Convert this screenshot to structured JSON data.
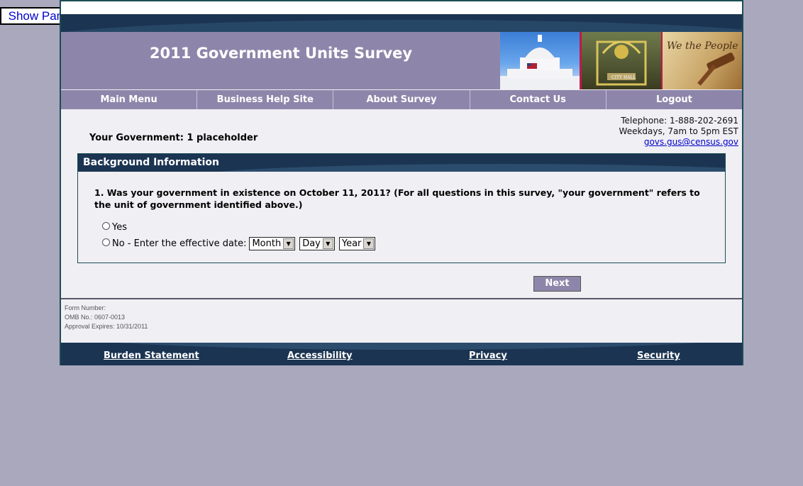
{
  "show_panel": {
    "label": "Show Panel"
  },
  "header": {
    "title": "2011 Government Units Survey",
    "photos": [
      "capitol-photo",
      "city-hall-photo",
      "constitution-gavel-photo"
    ]
  },
  "nav": {
    "items": [
      {
        "label": "Main Menu"
      },
      {
        "label": "Business Help Site"
      },
      {
        "label": "About Survey"
      },
      {
        "label": "Contact Us"
      },
      {
        "label": "Logout"
      }
    ]
  },
  "contact": {
    "telephone": "Telephone: 1-888-202-2691",
    "hours": "Weekdays, 7am to 5pm EST",
    "email": "govs.gus@census.gov"
  },
  "government": {
    "label": "Your Government: 1 placeholder"
  },
  "section": {
    "title": "Background Information",
    "question": "1. Was your government in existence on October 11, 2011? (For all questions in this survey, \"your government\" refers to the unit of government identified above.)",
    "option_yes": "Yes",
    "option_no": "No - Enter the effective date:",
    "month_select": "Month",
    "day_select": "Day",
    "year_select": "Year"
  },
  "next_button": {
    "label": "Next"
  },
  "form_meta": {
    "form_number": "Form Number:",
    "omb": "OMB No.: 0607-0013",
    "approval": "Approval Expires: 10/31/2011"
  },
  "footer": {
    "links": [
      {
        "label": "Burden Statement"
      },
      {
        "label": "Accessibility"
      },
      {
        "label": "Privacy"
      },
      {
        "label": "Security"
      }
    ]
  },
  "colors": {
    "page_bg": "#aaa8bd",
    "banner": "#8e86aa",
    "dark_band": "#1b3452",
    "link": "#0000cc"
  }
}
